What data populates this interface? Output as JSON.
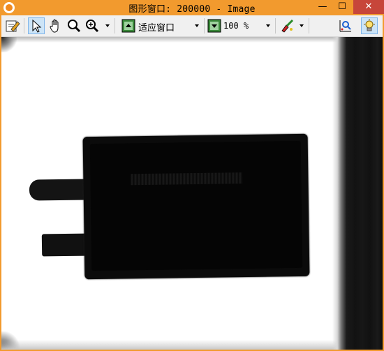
{
  "window": {
    "title": "图形窗口: 200000 - Image",
    "minimize_glyph": "—",
    "maximize_glyph": "☐",
    "close_glyph": "✕",
    "accent_color": "#f29a2e",
    "close_color": "#c7463a"
  },
  "toolbar": {
    "zoom_mode": "适应窗口",
    "zoom_percent": "100 %",
    "icons": [
      "edit-icon",
      "pointer-icon",
      "hand-icon",
      "magnifier-icon",
      "zoom-in-icon",
      "fit-window-icon",
      "zoom-percent-icon",
      "paint-icon",
      "graph-icon",
      "bulb-icon"
    ]
  },
  "canvas": {
    "background": "#ffffff",
    "subject": "battery-image"
  }
}
